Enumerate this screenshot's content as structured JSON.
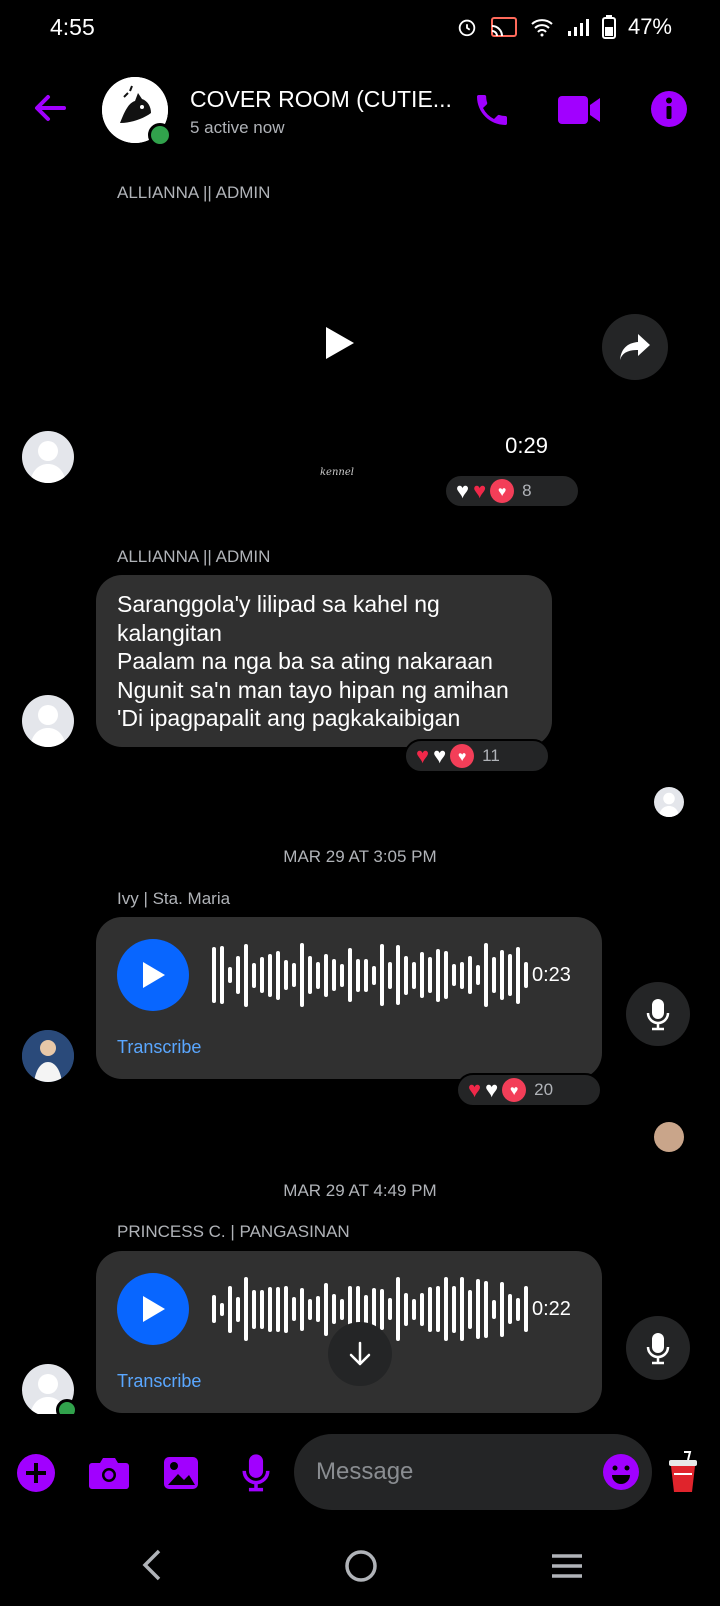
{
  "status_bar": {
    "time": "4:55",
    "battery": "47%"
  },
  "header": {
    "title": "COVER ROOM (CUTIE...",
    "subtitle": "5 active now"
  },
  "messages": [
    {
      "sender": "ALLIANNA || ADMIN",
      "video_duration": "0:29",
      "signature": "kennel",
      "reaction_count": "8"
    },
    {
      "sender": "ALLIANNA || ADMIN",
      "lines": [
        "Saranggola'y lilipad sa kahel ng",
        "kalangitan",
        "Paalam na nga ba sa ating nakaraan",
        "Ngunit sa'n man tayo hipan ng amihan",
        "'Di ipagpapalit ang pagkakaibigan"
      ],
      "reaction_count": "11"
    },
    {
      "timestamp": "MAR 29 AT 3:05 PM",
      "sender": "Ivy | Sta. Maria",
      "duration": "0:23",
      "transcribe": "Transcribe",
      "reaction_count": "20"
    },
    {
      "timestamp": "MAR 29 AT 4:49 PM",
      "sender": "PRINCESS C. | PANGASINAN",
      "duration": "0:22",
      "transcribe": "Transcribe"
    }
  ],
  "composer": {
    "placeholder": "Message"
  },
  "colors": {
    "accent": "#a100ff",
    "blue": "#0866ff",
    "bubble": "#303030"
  }
}
